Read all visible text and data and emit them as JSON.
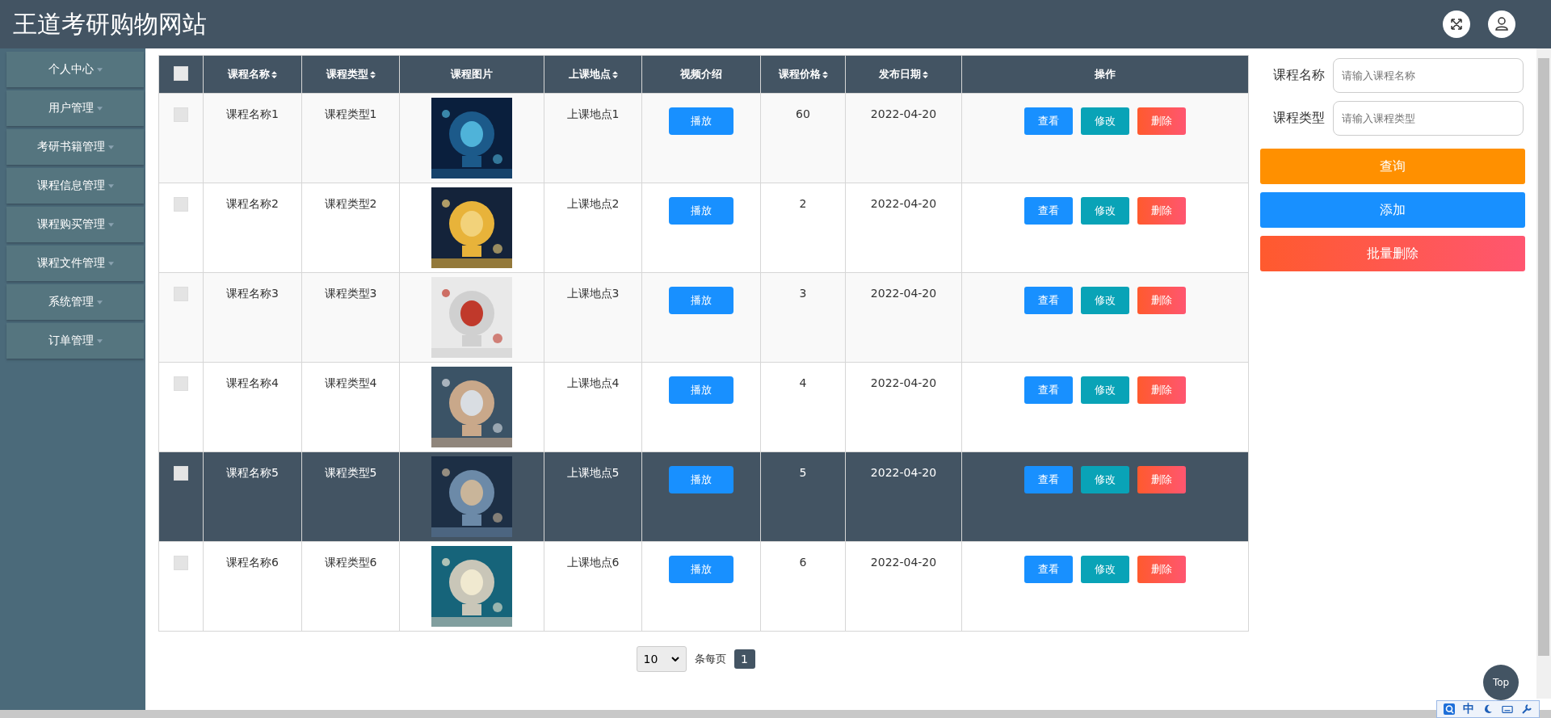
{
  "site_title": "王道考研购物网站",
  "sidebar": {
    "items": [
      {
        "label": "个人中心"
      },
      {
        "label": "用户管理"
      },
      {
        "label": "考研书籍管理"
      },
      {
        "label": "课程信息管理"
      },
      {
        "label": "课程购买管理"
      },
      {
        "label": "课程文件管理"
      },
      {
        "label": "系统管理"
      },
      {
        "label": "订单管理"
      }
    ]
  },
  "table": {
    "select_all": {
      "checked": false
    },
    "columns": [
      {
        "label": "课程名称",
        "sortable": true
      },
      {
        "label": "课程类型",
        "sortable": true
      },
      {
        "label": "课程图片",
        "sortable": false
      },
      {
        "label": "上课地点",
        "sortable": true
      },
      {
        "label": "视频介绍",
        "sortable": false
      },
      {
        "label": "课程价格",
        "sortable": true
      },
      {
        "label": "发布日期",
        "sortable": true
      },
      {
        "label": "操作",
        "sortable": false
      }
    ],
    "rows": [
      {
        "checked": false,
        "hovered": false,
        "name": "课程名称1",
        "type": "课程类型1",
        "location": "上课地点1",
        "play": "播放",
        "price": "60",
        "date": "2022-04-20",
        "actions": [
          "查看",
          "修改",
          "删除"
        ]
      },
      {
        "checked": false,
        "hovered": false,
        "name": "课程名称2",
        "type": "课程类型2",
        "location": "上课地点2",
        "play": "播放",
        "price": "2",
        "date": "2022-04-20",
        "actions": [
          "查看",
          "修改",
          "删除"
        ]
      },
      {
        "checked": false,
        "hovered": false,
        "name": "课程名称3",
        "type": "课程类型3",
        "location": "上课地点3",
        "play": "播放",
        "price": "3",
        "date": "2022-04-20",
        "actions": [
          "查看",
          "修改",
          "删除"
        ]
      },
      {
        "checked": false,
        "hovered": false,
        "name": "课程名称4",
        "type": "课程类型4",
        "location": "上课地点4",
        "play": "播放",
        "price": "4",
        "date": "2022-04-20",
        "actions": [
          "查看",
          "修改",
          "删除"
        ]
      },
      {
        "checked": false,
        "hovered": true,
        "name": "课程名称5",
        "type": "课程类型5",
        "location": "上课地点5",
        "play": "播放",
        "price": "5",
        "date": "2022-04-20",
        "actions": [
          "查看",
          "修改",
          "删除"
        ]
      },
      {
        "checked": false,
        "hovered": false,
        "name": "课程名称6",
        "type": "课程类型6",
        "location": "上课地点6",
        "play": "播放",
        "price": "6",
        "date": "2022-04-20",
        "actions": [
          "查看",
          "修改",
          "删除"
        ]
      }
    ]
  },
  "pagination": {
    "page_size": "10",
    "per_page_label": "条每页",
    "pages": [
      {
        "label": "1",
        "selected": true
      }
    ]
  },
  "search": {
    "fields": [
      {
        "label": "课程名称",
        "placeholder": "请输入课程名称"
      },
      {
        "label": "课程类型",
        "placeholder": "请输入课程类型"
      }
    ],
    "buttons": [
      {
        "kind": "query",
        "label": "查询"
      },
      {
        "kind": "add",
        "label": "添加"
      },
      {
        "kind": "batch_delete",
        "label": "批量删除"
      }
    ]
  },
  "back_to_top": "Top",
  "ime_bar": {
    "mode": "中"
  }
}
